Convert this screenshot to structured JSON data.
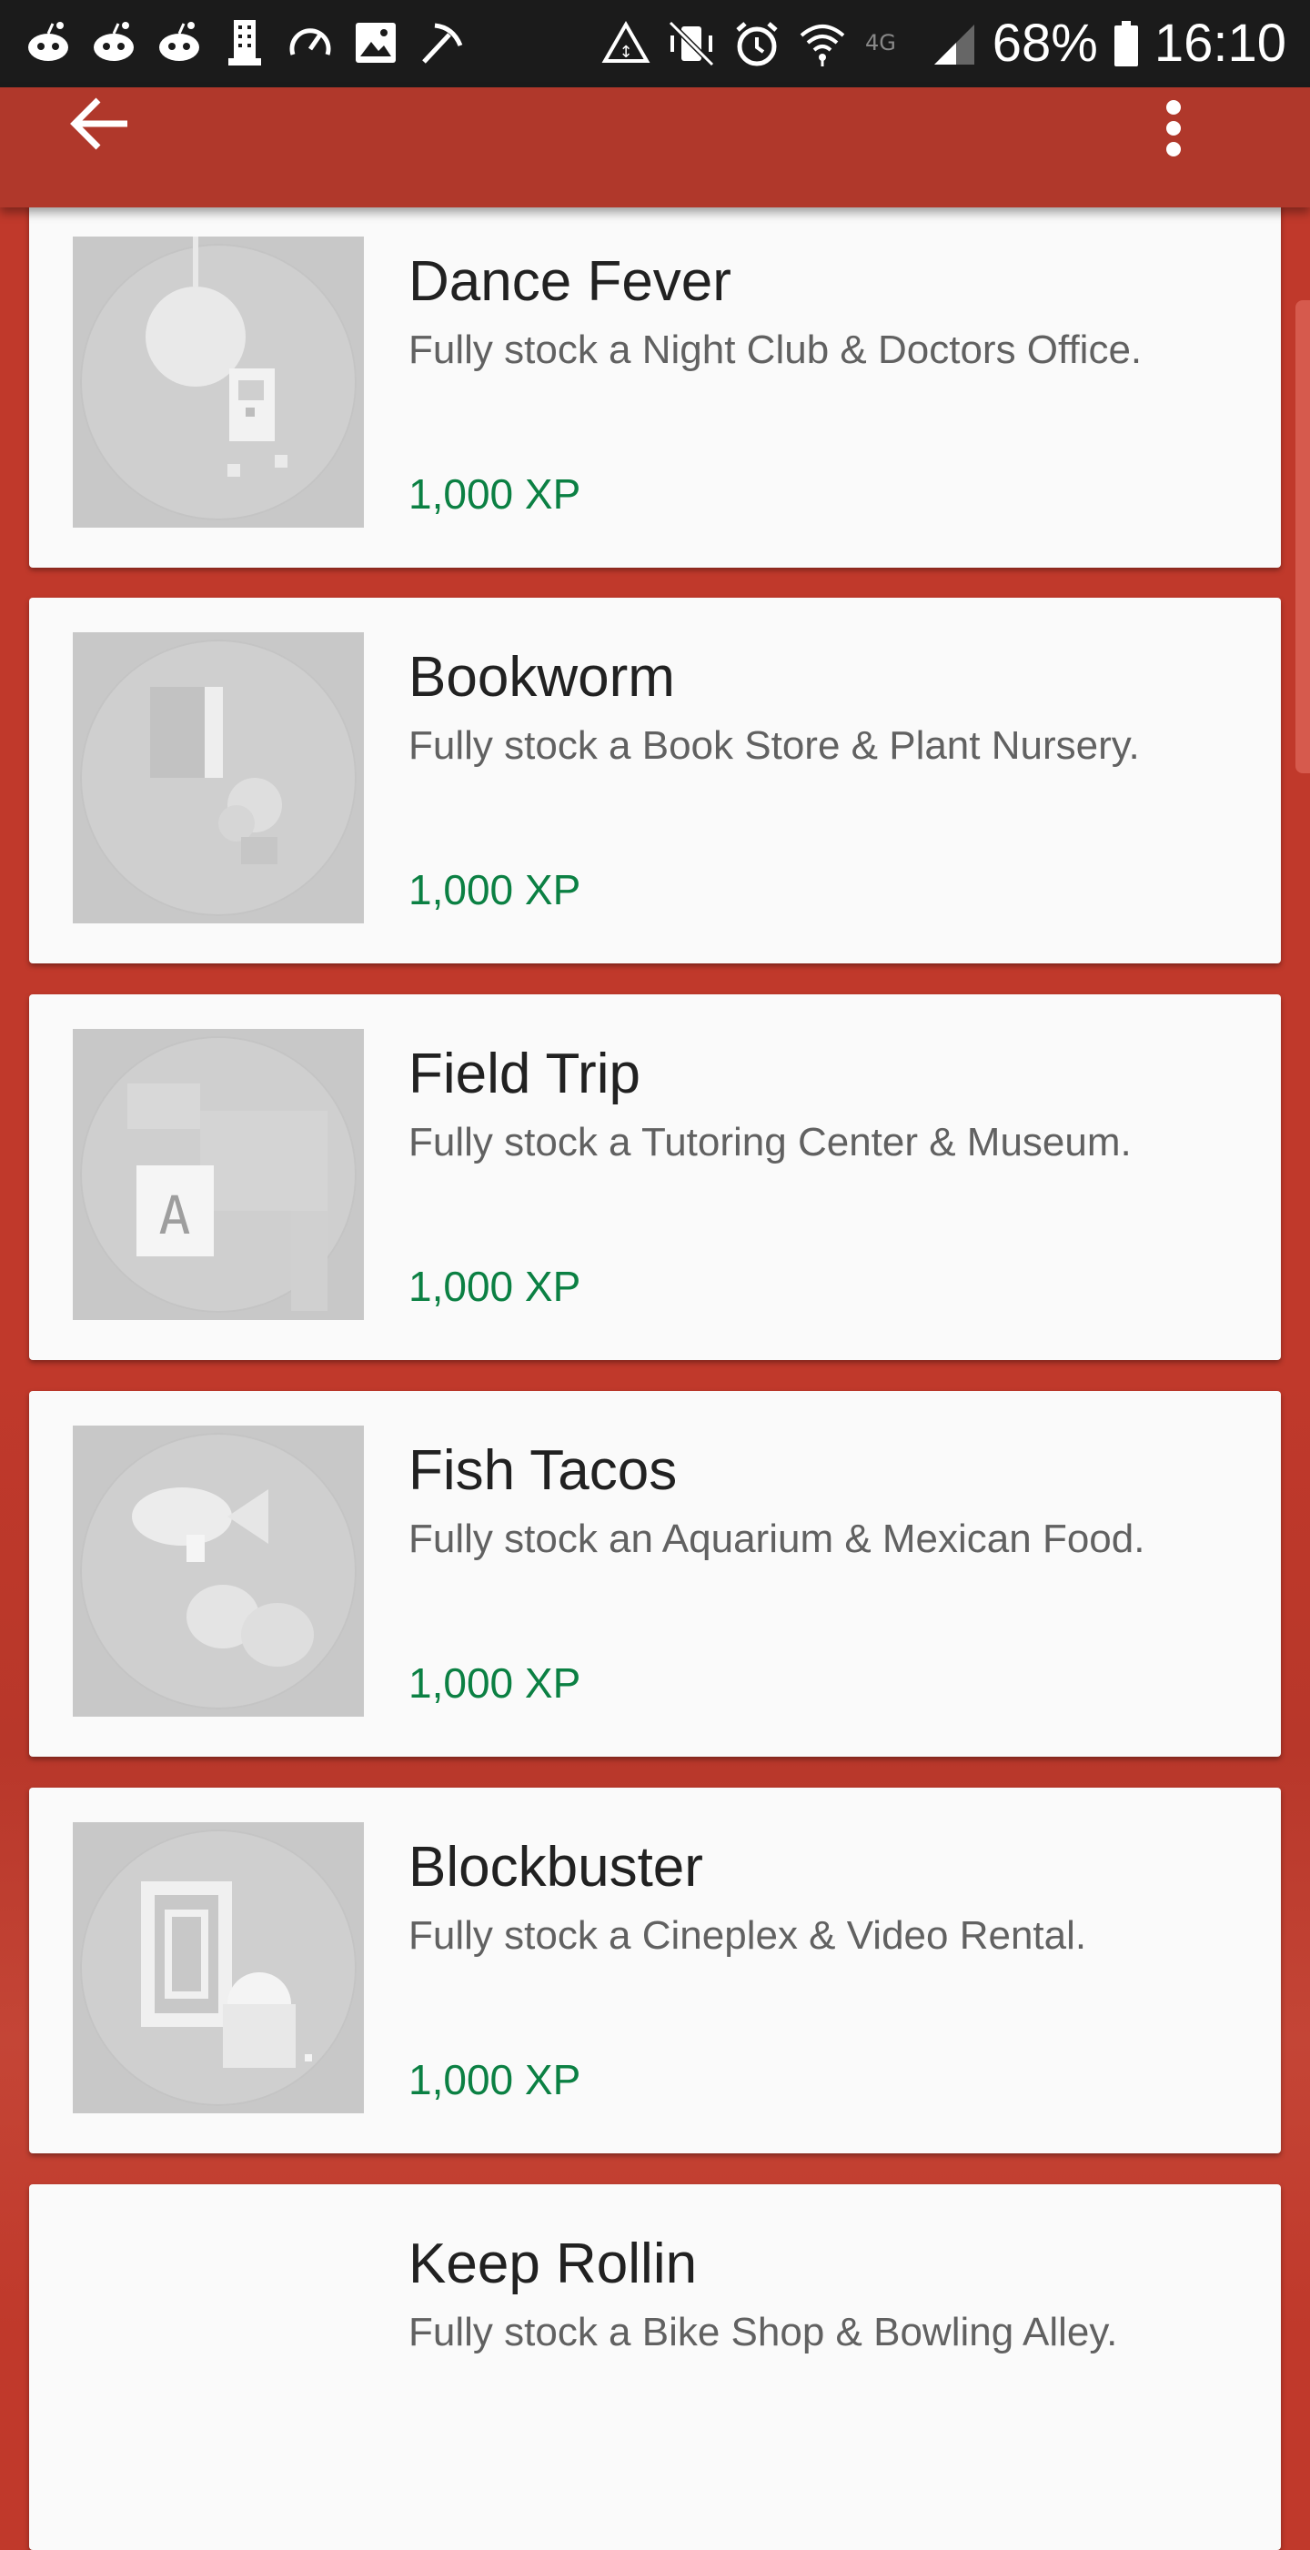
{
  "status_bar": {
    "battery": "68%",
    "time": "16:10",
    "left_icons": [
      "reddit-icon",
      "reddit-icon",
      "reddit-icon",
      "building-icon",
      "speedometer-icon",
      "image-icon",
      "pickaxe-icon"
    ],
    "right_icons": [
      "data-saver-icon",
      "vibrate-icon",
      "alarm-icon",
      "wifi-icon",
      "4g-icon",
      "signal-icon",
      "battery-icon"
    ]
  },
  "appbar": {
    "back_icon": "arrow-back-icon",
    "more_icon": "more-vert-icon"
  },
  "achievements": [
    {
      "title": "Dance Fever",
      "desc": "Fully stock a Night Club & Doctors Office.",
      "xp": "1,000 XP",
      "icon": "disco-ball-icon"
    },
    {
      "title": "Bookworm",
      "desc": "Fully stock a Book Store & Plant Nursery.",
      "xp": "1,000 XP",
      "icon": "book-plant-icon"
    },
    {
      "title": "Field Trip",
      "desc": "Fully stock a Tutoring Center & Museum.",
      "xp": "1,000 XP",
      "icon": "dinosaur-icon"
    },
    {
      "title": "Fish Tacos",
      "desc": "Fully stock an Aquarium & Mexican Food.",
      "xp": "1,000 XP",
      "icon": "fish-taco-icon"
    },
    {
      "title": "Blockbuster",
      "desc": "Fully stock a Cineplex & Video Rental.",
      "xp": "1,000 XP",
      "icon": "film-popcorn-icon"
    },
    {
      "title": "Keep Rollin",
      "desc": "Fully stock a Bike Shop & Bowling Alley.",
      "xp": "",
      "icon": "bike-icon"
    }
  ],
  "colors": {
    "accent": "#0b8043",
    "appbar": "#b0382b",
    "background": "#c0392b"
  }
}
